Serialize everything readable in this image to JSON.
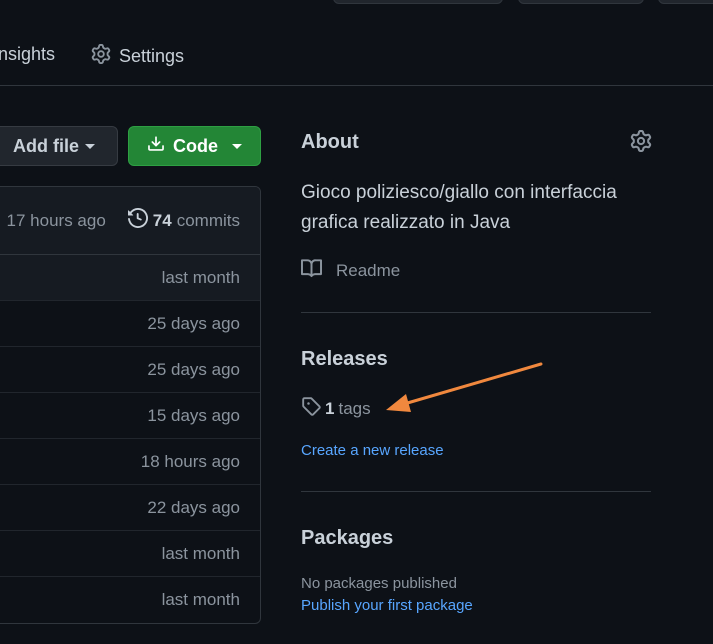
{
  "tabs": [
    {
      "label": "nsights",
      "icon": "graph-icon"
    },
    {
      "label": "Settings",
      "icon": "gear-icon"
    }
  ],
  "buttons": {
    "add_file": "Add file",
    "code": "Code"
  },
  "commit_bar": {
    "time": "17 hours ago",
    "commit_count": "74",
    "commit_label": "commits"
  },
  "file_rows": [
    {
      "age": "last month"
    },
    {
      "age": "25 days ago"
    },
    {
      "age": "25 days ago"
    },
    {
      "age": "15 days ago"
    },
    {
      "age": "18 hours ago"
    },
    {
      "age": "22 days ago"
    },
    {
      "age": "last month"
    },
    {
      "age": "last month"
    }
  ],
  "about": {
    "title": "About",
    "description": "Gioco poliziesco/giallo con interfaccia grafica realizzato in Java",
    "readme": "Readme"
  },
  "releases": {
    "title": "Releases",
    "tag_count": "1",
    "tag_label": "tags",
    "create_link": "Create a new release"
  },
  "packages": {
    "title": "Packages",
    "empty_text": "No packages published",
    "publish_link": "Publish your first package"
  },
  "colors": {
    "background": "#0d1117",
    "accent_green": "#238636",
    "link_blue": "#58a6ff",
    "annotation_arrow": "#f0883e"
  }
}
